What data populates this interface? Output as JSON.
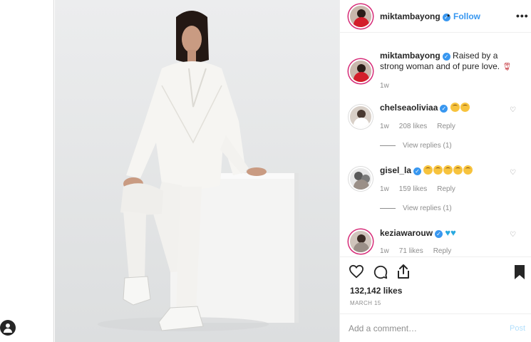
{
  "post": {
    "username": "miktambayong",
    "verified_mark": "✓",
    "dot": "•",
    "follow_label": "Follow",
    "more_label": "•••",
    "caption": {
      "username": "miktambayong",
      "text": "Raised by a strong woman and of pure love.",
      "emoji": "rose",
      "time": "1w"
    },
    "likes": "132,142 likes",
    "date": "MARCH 15",
    "add_comment_placeholder": "Add a comment…",
    "post_label": "Post"
  },
  "comments": [
    {
      "username": "chelseaoliviaa",
      "emojis": [
        "smiling-face",
        "face-savoring-food"
      ],
      "time": "1w",
      "likes": "208 likes",
      "reply": "Reply",
      "view_replies": "View replies (1)"
    },
    {
      "username": "gisel_la",
      "emojis": [
        "smiling-face",
        "smiling-face",
        "smiling-face",
        "smiling-face",
        "smiling-face"
      ],
      "time": "1w",
      "likes": "159 likes",
      "reply": "Reply",
      "view_replies": "View replies (1)"
    },
    {
      "username": "keziawarouw",
      "emojis": [
        "blue-heart",
        "blue-heart"
      ],
      "time": "1w",
      "likes": "71 likes",
      "reply": "Reply"
    }
  ],
  "icons": {
    "like": "heart-outline-icon",
    "comment": "comment-bubble-icon",
    "share": "share-upload-icon",
    "save": "bookmark-filled-icon"
  },
  "colors": {
    "link_blue": "#3897f0",
    "story_ring": "#d62976",
    "muted": "#8e8e8e"
  }
}
